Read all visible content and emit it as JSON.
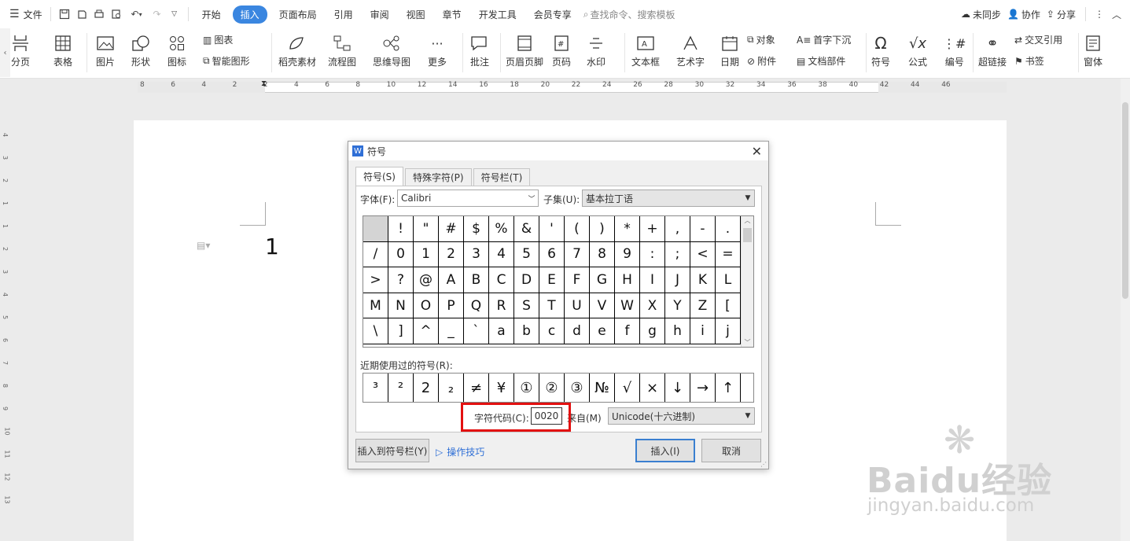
{
  "menu": {
    "file": "文件",
    "tabs": [
      "开始",
      "插入",
      "页面布局",
      "引用",
      "审阅",
      "视图",
      "章节",
      "开发工具",
      "会员专享"
    ],
    "active_tab": "插入",
    "search": "查找命令、搜索模板",
    "right": {
      "sync": "未同步",
      "collab": "协作",
      "share": "分享"
    }
  },
  "ribbon": {
    "pagebreak": "分页",
    "table": "表格",
    "picture": "图片",
    "shape": "形状",
    "icon": "图标",
    "chart": "图表",
    "smartart": "智能图形",
    "material": "稻壳素材",
    "flowchart": "流程图",
    "mindmap": "思维导图",
    "more": "更多",
    "comment": "批注",
    "header_footer": "页眉页脚",
    "page_number": "页码",
    "watermark": "水印",
    "textbox": "文本框",
    "wordart": "艺术字",
    "date": "日期",
    "object": "对象",
    "attachment": "附件",
    "dropcap": "首字下沉",
    "docparts": "文档部件",
    "symbol": "符号",
    "formula": "公式",
    "numbering": "编号",
    "hyperlink": "超链接",
    "crossref": "交叉引用",
    "bookmark": "书签",
    "window": "窗体"
  },
  "ruler": {
    "top": [
      "8",
      "6",
      "4",
      "2",
      "2",
      "4",
      "6",
      "8",
      "10",
      "12",
      "14",
      "16",
      "18",
      "20",
      "22",
      "24",
      "26",
      "28",
      "30",
      "32",
      "34",
      "36",
      "38",
      "40",
      "42",
      "44",
      "46"
    ],
    "left": [
      "4",
      "3",
      "2",
      "1",
      "1",
      "2",
      "3",
      "4",
      "5",
      "6",
      "7",
      "8",
      "9",
      "10",
      "11",
      "12",
      "13"
    ]
  },
  "document": {
    "text": "1"
  },
  "dialog": {
    "title": "符号",
    "tabs": [
      "符号(S)",
      "特殊字符(P)",
      "符号栏(T)"
    ],
    "font_label": "字体(F):",
    "font_value": "Calibri",
    "subset_label": "子集(U):",
    "subset_value": "基本拉丁语",
    "symbols": [
      " ",
      "!",
      "\"",
      "#",
      "$",
      "%",
      "&",
      "'",
      "(",
      ")",
      "*",
      "+",
      ",",
      "-",
      ".",
      "/",
      "0",
      "1",
      "2",
      "3",
      "4",
      "5",
      "6",
      "7",
      "8",
      "9",
      ":",
      ";",
      "<",
      "=",
      ">",
      "?",
      "@",
      "A",
      "B",
      "C",
      "D",
      "E",
      "F",
      "G",
      "H",
      "I",
      "J",
      "K",
      "L",
      "M",
      "N",
      "O",
      "P",
      "Q",
      "R",
      "S",
      "T",
      "U",
      "V",
      "W",
      "X",
      "Y",
      "Z",
      "[",
      "\\",
      "]",
      "^",
      "_",
      "`",
      "a",
      "b",
      "c",
      "d",
      "e",
      "f",
      "g",
      "h",
      "i",
      "j"
    ],
    "recent_label": "近期使用过的符号(R):",
    "recent": [
      "³",
      "²",
      "2",
      "₂",
      "≠",
      "¥",
      "①",
      "②",
      "③",
      "№",
      "√",
      "×",
      "↓",
      "→",
      "↑"
    ],
    "charcode_label": "字符代码(C):",
    "charcode_value": "0020",
    "from_label": "来自(M)",
    "from_value": "Unicode(十六进制)",
    "insert_to_bar": "插入到符号栏(Y)",
    "tips": "操作技巧",
    "insert": "插入(I)",
    "cancel": "取消"
  },
  "watermark": {
    "brand": "Baidu经验",
    "url": "jingyan.baidu.com"
  }
}
